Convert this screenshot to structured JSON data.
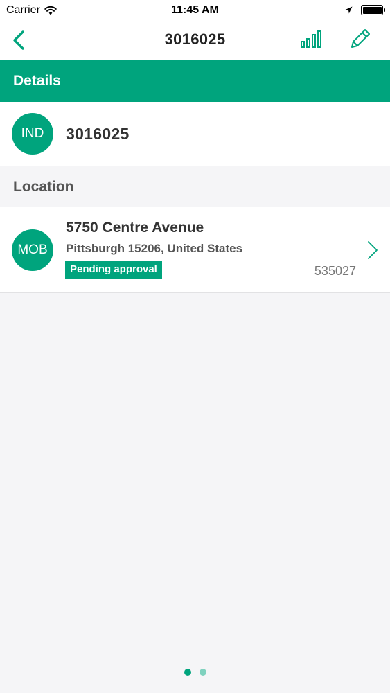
{
  "status_bar": {
    "carrier": "Carrier",
    "time": "11:45 AM",
    "battery_level": 1.0
  },
  "nav": {
    "title": "3016025",
    "back_icon": "chevron-left-icon",
    "stats_icon": "bar-chart-icon",
    "edit_icon": "pencil-icon"
  },
  "details": {
    "header": "Details",
    "avatar": "IND",
    "id": "3016025"
  },
  "location": {
    "header": "Location",
    "avatar": "MOB",
    "address": "5750 Centre Avenue",
    "city_line": "Pittsburgh 15206, United States",
    "badge": "Pending approval",
    "number": "535027"
  },
  "pager": {
    "total": 2,
    "active": 0
  },
  "colors": {
    "accent": "#00a47d",
    "inactive_dot": "#7fd1be"
  }
}
